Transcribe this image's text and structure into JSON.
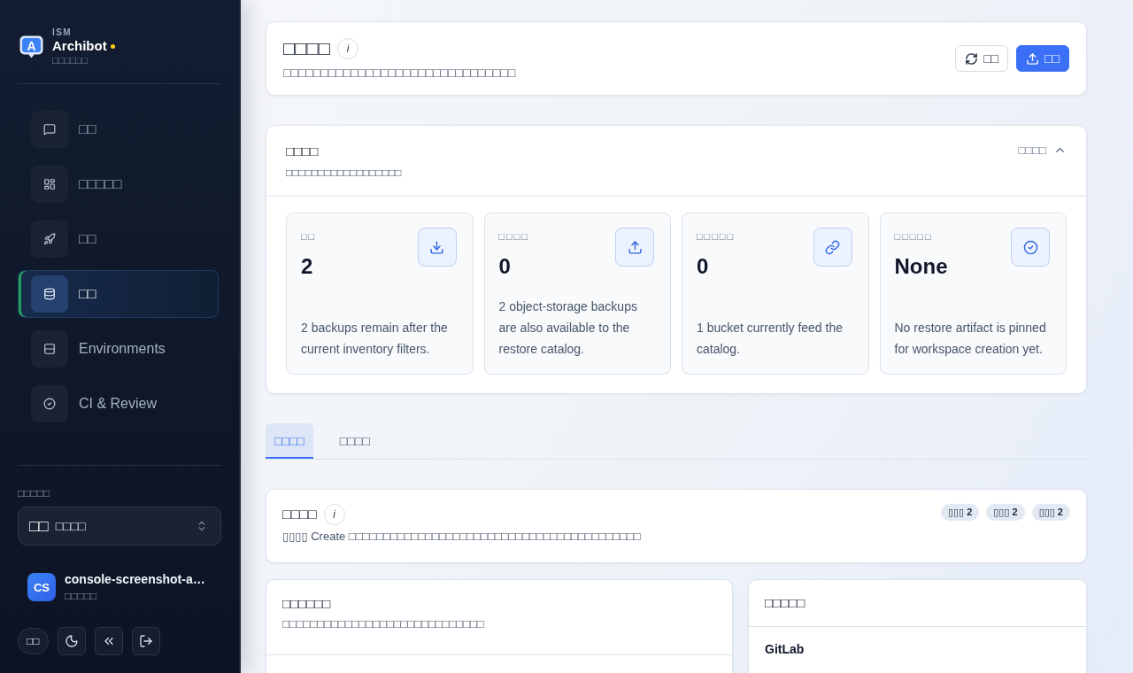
{
  "sidebar": {
    "brand": {
      "logo_letter": "A",
      "eyebrow": "ISM",
      "name": "Archibot",
      "subtitle": "□□□□□□"
    },
    "nav_items": [
      {
        "label": "□□",
        "selected": false
      },
      {
        "label": "□□□□□",
        "selected": false
      },
      {
        "label": "□□",
        "selected": false
      },
      {
        "label": "□□",
        "selected": true
      },
      {
        "label": "Environments",
        "selected": false
      },
      {
        "label": "CI & Review",
        "selected": false
      }
    ],
    "workspace": {
      "label": "□□□□□",
      "selector": {
        "emblem": "□□",
        "value": "□□□□"
      }
    },
    "user": {
      "initials": "CS",
      "name": "console-screenshot-a…",
      "role": "□□□□□"
    },
    "footer": {
      "language": "□□"
    }
  },
  "header": {
    "title": "□□□□",
    "info_glyph": "i",
    "subtitle": "□□□□□□□□□□□□□□□□□□□□□□□□□□□□□□□",
    "buttons": [
      {
        "label": "□□",
        "kind": "secondary"
      },
      {
        "label": "□□",
        "kind": "primary"
      }
    ]
  },
  "summary": {
    "title": "□□□□",
    "subtitle": "□□□□□□□□□□□□□□□□□□",
    "toggle_label": "□□□□",
    "expanded": true,
    "stats": [
      {
        "label": "□□",
        "value": "2",
        "description": "2 backups remain after the current inventory filters."
      },
      {
        "label": "□□□□",
        "value": "0",
        "description": "2 object‑storage backups are also available to the restore catalog."
      },
      {
        "label": "□□□□□",
        "value": "0",
        "description": "1 bucket currently feed the catalog."
      },
      {
        "label": "□□□□□",
        "value": "None",
        "description": "No restore artifact is pinned for workspace creation yet."
      }
    ]
  },
  "tabs": [
    {
      "label": "□□□□",
      "selected": true
    },
    {
      "label": "□□□□",
      "selected": false
    }
  ],
  "section": {
    "title": "□□□□",
    "info_glyph": "i",
    "description": "▯▯▯▯ Create □□□□□□□□□□□□□□□□□□□□□□□□□□□□□□□□□□□□□□□□□□",
    "badges": [
      "▯▯▯ 2",
      "▯▯▯ 2",
      "▯▯▯ 2"
    ]
  },
  "panels": {
    "left": {
      "title": "□□□□□□",
      "subtitle": "□□□□□□□□□□□□□□□□□□□□□□□□□□□□□"
    },
    "right": {
      "title": "□□□□□",
      "items": [
        {
          "name": "GitLab"
        }
      ]
    }
  }
}
